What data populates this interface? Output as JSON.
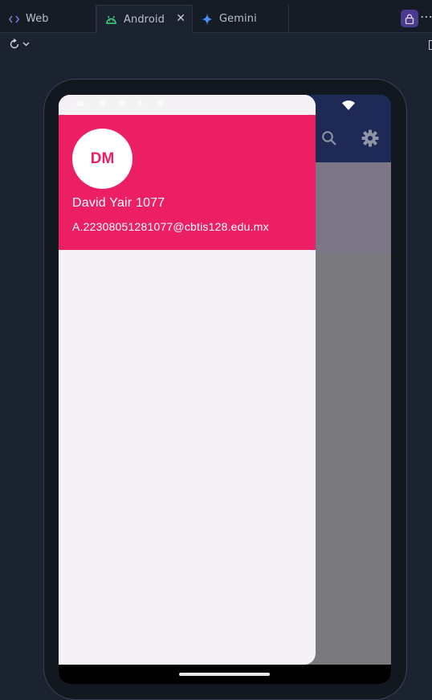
{
  "tabs": [
    {
      "label": "Web",
      "icon": "code-icon"
    },
    {
      "label": "Android",
      "icon": "android-icon"
    },
    {
      "label": "Gemini",
      "icon": "gemini-sparkle-icon"
    }
  ],
  "colors": {
    "ide_bg": "#1b2230",
    "app_bar": "#1e2a55",
    "drawer_header": "#ec1f64",
    "drawer_bg": "#f5f2f6",
    "accent_lock": "#4b3b8f"
  },
  "drawer": {
    "avatar_initials": "DM",
    "user_name": "David Yair 1077",
    "user_email": "A.22308051281077@cbtis128.edu.mx"
  }
}
